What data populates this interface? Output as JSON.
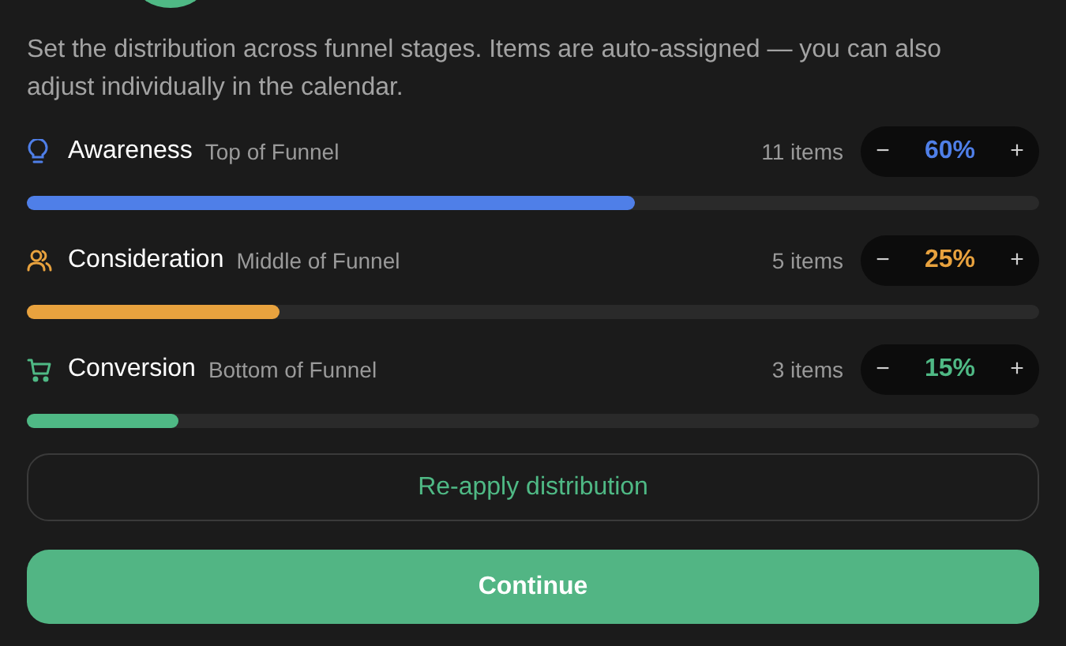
{
  "description": "Set the distribution across funnel stages. Items are auto-assigned — you can also adjust individually in the calendar.",
  "stages": [
    {
      "kind": "bulb",
      "name": "Awareness",
      "subtitle": "Top of Funnel",
      "count": "11 items",
      "minus": "−",
      "percent": "60%",
      "plus": "+",
      "level": 0.6,
      "color": "#4f7fe8"
    },
    {
      "kind": "people",
      "name": "Consideration",
      "subtitle": "Middle of Funnel",
      "count": "5 items",
      "minus": "−",
      "percent": "25%",
      "plus": "+",
      "level": 0.25,
      "color": "#e8a23e"
    },
    {
      "kind": "cart",
      "name": "Conversion",
      "subtitle": "Bottom of Funnel",
      "count": "3 items",
      "minus": "−",
      "percent": "15%",
      "plus": "+",
      "level": 0.15,
      "color": "#4fb985"
    }
  ],
  "reapply_button": "Re-apply distribution",
  "continue_button": "Continue"
}
